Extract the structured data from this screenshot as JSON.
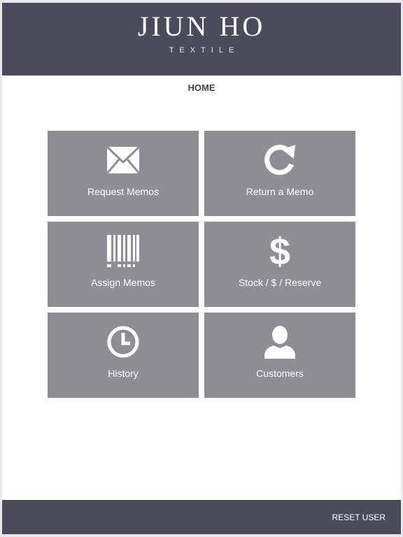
{
  "header": {
    "brand": "JIUN HO",
    "subtitle": "TEXTILE"
  },
  "page": {
    "title": "HOME"
  },
  "tiles": [
    {
      "label": "Request Memos",
      "icon": "envelope-icon"
    },
    {
      "label": "Return a Memo",
      "icon": "refresh-icon"
    },
    {
      "label": "Assign Memos",
      "icon": "barcode-icon"
    },
    {
      "label": "Stock / $ / Reserve",
      "icon": "dollar-icon"
    },
    {
      "label": "History",
      "icon": "clock-icon"
    },
    {
      "label": "Customers",
      "icon": "person-icon"
    }
  ],
  "footer": {
    "reset_label": "RESET USER"
  },
  "colors": {
    "bar": "#4c4b59",
    "tile": "#8e8e93",
    "text_dark": "#444450"
  }
}
